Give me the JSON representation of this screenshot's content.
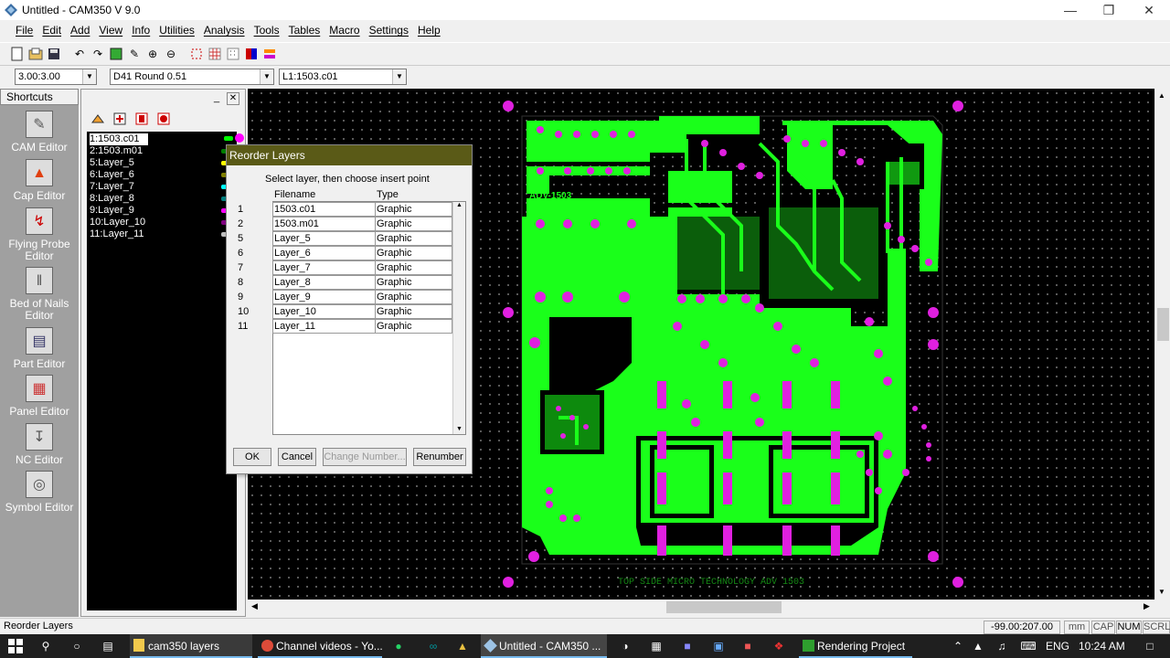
{
  "window": {
    "title": "Untitled - CAM350 V 9.0"
  },
  "menu": [
    "File",
    "Edit",
    "Add",
    "View",
    "Info",
    "Utilities",
    "Analysis",
    "Tools",
    "Tables",
    "Macro",
    "Settings",
    "Help"
  ],
  "combos": {
    "grid": "3.00:3.00",
    "dcode": "D41   Round 0.51",
    "layer": "L1:1503.c01"
  },
  "shortcuts": {
    "title": "Shortcuts",
    "items": [
      "CAM Editor",
      "Cap Editor",
      "Flying Probe Editor",
      "Bed of Nails Editor",
      "Part Editor",
      "Panel Editor",
      "NC Editor",
      "Symbol Editor"
    ]
  },
  "layers": [
    {
      "label": "1:1503.c01",
      "color": "#00ff00"
    },
    {
      "label": "2:1503.m01",
      "color": "#008000"
    },
    {
      "label": "5:Layer_5",
      "color": "#ffff00"
    },
    {
      "label": "6:Layer_6",
      "color": "#808000"
    },
    {
      "label": "7:Layer_7",
      "color": "#00ffff"
    },
    {
      "label": "8:Layer_8",
      "color": "#008080"
    },
    {
      "label": "9:Layer_9",
      "color": "#ff00ff"
    },
    {
      "label": "10:Layer_10",
      "color": "#800080"
    },
    {
      "label": "11:Layer_11",
      "color": "#c0c0c0"
    }
  ],
  "dialog": {
    "title": "Reorder Layers",
    "instruction": "Select layer, then choose insert point",
    "col_filename": "Filename",
    "col_type": "Type",
    "rows": [
      {
        "num": "1",
        "file": "1503.c01",
        "type": "Graphic"
      },
      {
        "num": "2",
        "file": "1503.m01",
        "type": "Graphic"
      },
      {
        "num": "5",
        "file": "Layer_5",
        "type": "Graphic"
      },
      {
        "num": "6",
        "file": "Layer_6",
        "type": "Graphic"
      },
      {
        "num": "7",
        "file": "Layer_7",
        "type": "Graphic"
      },
      {
        "num": "8",
        "file": "Layer_8",
        "type": "Graphic"
      },
      {
        "num": "9",
        "file": "Layer_9",
        "type": "Graphic"
      },
      {
        "num": "10",
        "file": "Layer_10",
        "type": "Graphic"
      },
      {
        "num": "11",
        "file": "Layer_11",
        "type": "Graphic"
      }
    ],
    "ok": "OK",
    "cancel": "Cancel",
    "change_number": "Change Number...",
    "renumber": "Renumber"
  },
  "board": {
    "label": "ADV-1503",
    "bottom_text": "TOP SIDE MICRO TECHNOLOGY ADV 1503",
    "copper_color": "#00ff00",
    "pad_color": "#e020e0"
  },
  "status": {
    "text": "Reorder Layers",
    "coords": "-99.00:207.00",
    "units": "mm",
    "cap": "CAP",
    "num": "NUM",
    "scrl": "SCRL"
  },
  "taskbar": {
    "apps": [
      "cam350 layers",
      "Channel videos - Yo...",
      "Untitled - CAM350 ...",
      "Rendering Project"
    ],
    "lang": "ENG",
    "time": "10:24 AM"
  }
}
